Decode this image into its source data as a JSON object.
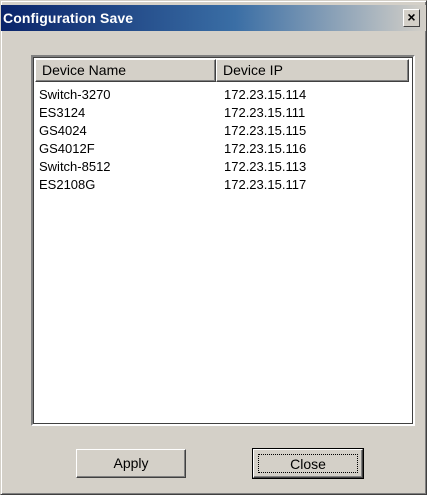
{
  "window": {
    "title": "Configuration Save",
    "close_glyph": "×"
  },
  "list": {
    "columns": [
      "Device Name",
      "Device IP"
    ],
    "rows": [
      {
        "name": "Switch-3270",
        "ip": "172.23.15.114"
      },
      {
        "name": "ES3124",
        "ip": "172.23.15.111"
      },
      {
        "name": "GS4024",
        "ip": "172.23.15.115"
      },
      {
        "name": "GS4012F",
        "ip": "172.23.15.116"
      },
      {
        "name": "Switch-8512",
        "ip": "172.23.15.113"
      },
      {
        "name": "ES2108G",
        "ip": "172.23.15.117"
      }
    ]
  },
  "buttons": {
    "apply_label": "Apply",
    "close_label": "Close"
  },
  "colors": {
    "title_bar_start": "#0a246a",
    "title_bar_end": "#d4d0c8",
    "dialog_face": "#d4d0c8"
  }
}
